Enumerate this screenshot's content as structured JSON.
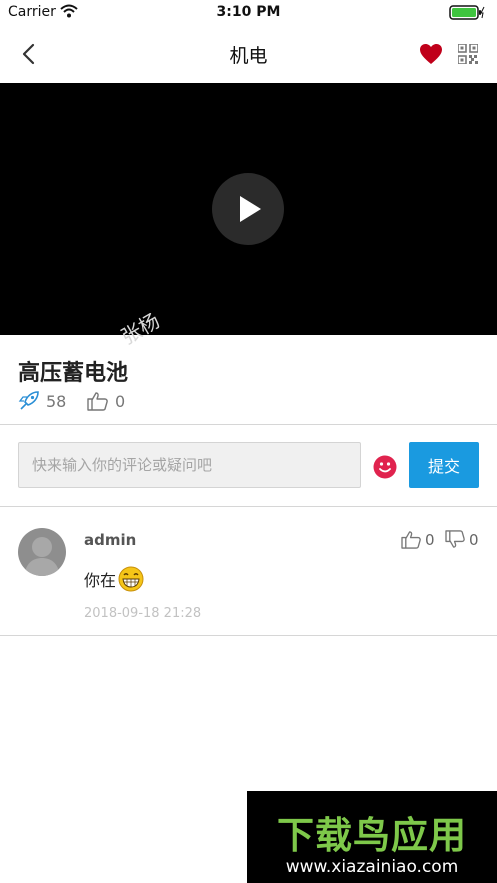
{
  "status_bar": {
    "carrier": "Carrier",
    "time": "3:10 PM"
  },
  "nav": {
    "title": "机电"
  },
  "video": {
    "watermark": "张杨"
  },
  "info": {
    "title": "高压蓄电池",
    "views": "58",
    "likes": "0"
  },
  "comment_form": {
    "placeholder": "快来输入你的评论或疑问吧",
    "submit_label": "提交"
  },
  "comments": [
    {
      "user": "admin",
      "text": "你在",
      "time": "2018-09-18 21:28",
      "likes": "0",
      "dislikes": "0"
    }
  ],
  "ad": {
    "brand": "下载鸟应用",
    "url": "www.xiazainiao.com"
  },
  "colors": {
    "accent": "#1a9ae0",
    "heart": "#c0001a",
    "emoji": "#e0234e",
    "ad_green": "#7ec84a"
  }
}
